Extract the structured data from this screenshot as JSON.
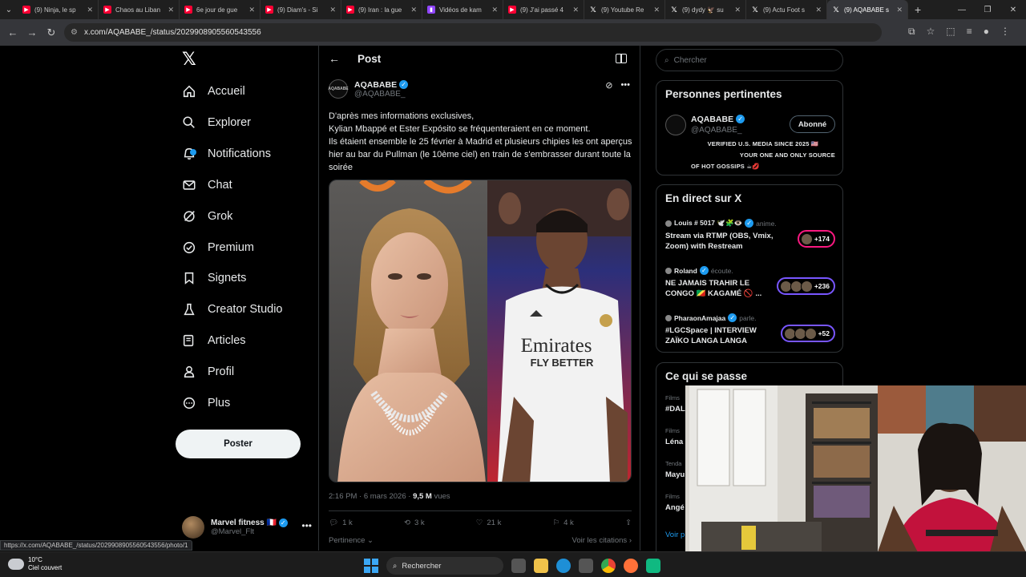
{
  "browser": {
    "tabs": [
      {
        "title": "(9) Ninja, le sp",
        "icon": "youtube"
      },
      {
        "title": "Chaos au Liban",
        "icon": "youtube"
      },
      {
        "title": "6e jour de gue",
        "icon": "youtube"
      },
      {
        "title": "(9) Diam's - Si",
        "icon": "youtube"
      },
      {
        "title": "(9) Iran : la gue",
        "icon": "youtube"
      },
      {
        "title": "Vidéos de kam",
        "icon": "twitch"
      },
      {
        "title": "(9) J'ai passé 4",
        "icon": "youtube"
      },
      {
        "title": "(9) Youtube Re",
        "icon": "x"
      },
      {
        "title": "(9) dydy 🦅 su",
        "icon": "x"
      },
      {
        "title": "(9) Actu Foot s",
        "icon": "x"
      },
      {
        "title": "(9) AQABABE s",
        "icon": "x"
      }
    ],
    "url": "x.com/AQABABE_/status/2029908905560543556",
    "status_url": "https://x.com/AQABABE_/status/2029908905560543556/photo/1"
  },
  "nav": {
    "items": [
      {
        "label": "Accueil",
        "icon": "home-icon"
      },
      {
        "label": "Explorer",
        "icon": "search-icon"
      },
      {
        "label": "Notifications",
        "icon": "bell-icon"
      },
      {
        "label": "Chat",
        "icon": "mail-icon"
      },
      {
        "label": "Grok",
        "icon": "grok-icon"
      },
      {
        "label": "Premium",
        "icon": "premium-icon"
      },
      {
        "label": "Signets",
        "icon": "bookmark-icon"
      },
      {
        "label": "Creator Studio",
        "icon": "creator-icon"
      },
      {
        "label": "Articles",
        "icon": "article-icon"
      },
      {
        "label": "Profil",
        "icon": "person-icon"
      },
      {
        "label": "Plus",
        "icon": "more-icon"
      }
    ],
    "post_button": "Poster",
    "account": {
      "name": "Marvel fitness 🇫🇷",
      "handle": "@Marvel_Flt"
    }
  },
  "post": {
    "header": "Post",
    "author_name": "AQABABE",
    "author_handle": "@AQABABE_",
    "avatar_text": "AQABABE",
    "text_lines": [
      "D'après mes informations exclusives,",
      "Kylian Mbappé et Ester Expósito se fréquenteraient en ce moment.",
      "Ils étaient ensemble le 25 février à Madrid et plusieurs chipies les ont aperçus hier au bar du Pullman (le 10ème ciel) en train de s'embrasser durant toute la soirée"
    ],
    "image_jersey_line1": "Emirates",
    "image_jersey_line2": "FLY BETTER",
    "meta_time": "2:16 PM · 6 mars 2026 · ",
    "meta_views_value": "9,5 M",
    "meta_views_label": " vues",
    "actions": {
      "replies": "1 k",
      "reposts": "3 k",
      "likes": "21 k",
      "bookmarks": "4 k"
    },
    "sort_label": "Pertinence",
    "quotes_label": "Voir les citations"
  },
  "sidebar": {
    "search_placeholder": "Chercher",
    "relevant": {
      "title": "Personnes pertinentes",
      "name": "AQABABE",
      "handle": "@AQABABE_",
      "follow_label": "Abonné",
      "bio_lines": [
        "VERIFIED U.S. MEDIA SINCE 2025 🇺🇸",
        "YOUR ONE AND ONLY SOURCE",
        "OF HOT GOSSIPS ☕💋"
      ]
    },
    "live": {
      "title": "En direct sur X",
      "items": [
        {
          "host": "Louis # 5017 🕊️🧩👁️",
          "status": "anime.",
          "title": "Stream via RTMP (OBS, Vmix, Zoom) with Restream",
          "count": "+174"
        },
        {
          "host": "Roland",
          "status": "écoute.",
          "title": "NE JAMAIS TRAHIR LE CONGO 🇨🇬 KAGAMÉ 🚫 ...",
          "count": "+236"
        },
        {
          "host": "PharaonAmajaa",
          "status": "parle.",
          "title": "#LGCSpace | INTERVIEW ZAÏKO LANGA LANGA",
          "count": "+52"
        }
      ]
    },
    "trending": {
      "title": "Ce qui se passe",
      "items": [
        {
          "category": "Films",
          "term": "#DAL"
        },
        {
          "category": "Films",
          "term": "Léna"
        },
        {
          "category": "Tenda",
          "term": "Mayu"
        },
        {
          "category": "Films",
          "term": "Angé"
        }
      ],
      "more": "Voir p"
    }
  },
  "taskbar": {
    "weather_temp": "10°C",
    "weather_desc": "Ciel couvert",
    "search_label": "Rechercher"
  }
}
